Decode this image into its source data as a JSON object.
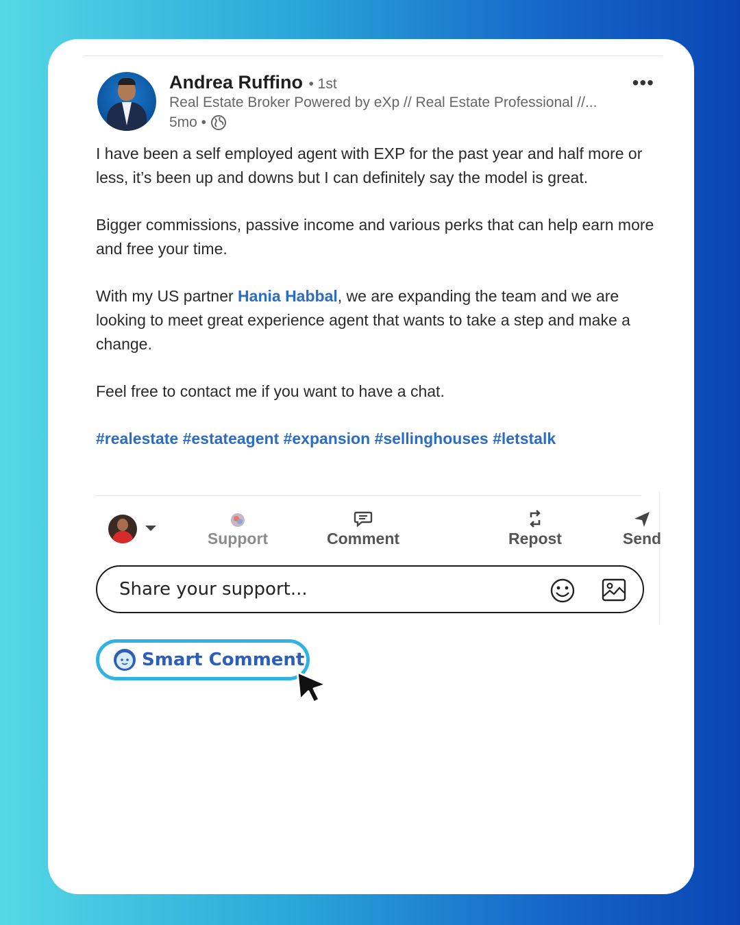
{
  "post": {
    "author": {
      "name": "Andrea Ruffino",
      "degree": "• 1st",
      "headline": "Real Estate Broker Powered by eXp // Real Estate Professional //...",
      "time": "5mo •"
    },
    "paragraphs": {
      "p1": "I have been a self employed agent with EXP for the past year and half more or less, it’s been up and downs but I can definitely say the model is great.",
      "p2": "Bigger commissions, passive income and various perks that can help earn more and free your time.",
      "p3_before": "With my US partner ",
      "p3_mention": "Hania Habbal",
      "p3_after": ", we are expanding the team and we are looking to meet great experience agent that wants to take a step and make a change.",
      "p4": "Feel free to contact me if you want to have a chat."
    },
    "hashtags": "#realestate #estateagent #expansion #sellinghouses #letstalk"
  },
  "actions": {
    "support": "Support",
    "comment": "Comment",
    "repost": "Repost",
    "send": "Send"
  },
  "comment_box": {
    "placeholder": "Share your support..."
  },
  "smart_comment": {
    "label": "Smart Comment"
  },
  "icons": {
    "more": "more-options-icon",
    "visibility": "globe-icon",
    "emoji": "emoji-icon",
    "image": "image-icon",
    "cursor": "cursor-icon"
  },
  "colors": {
    "link": "#2b6cc4",
    "smart_border": "#2fb3e4"
  }
}
